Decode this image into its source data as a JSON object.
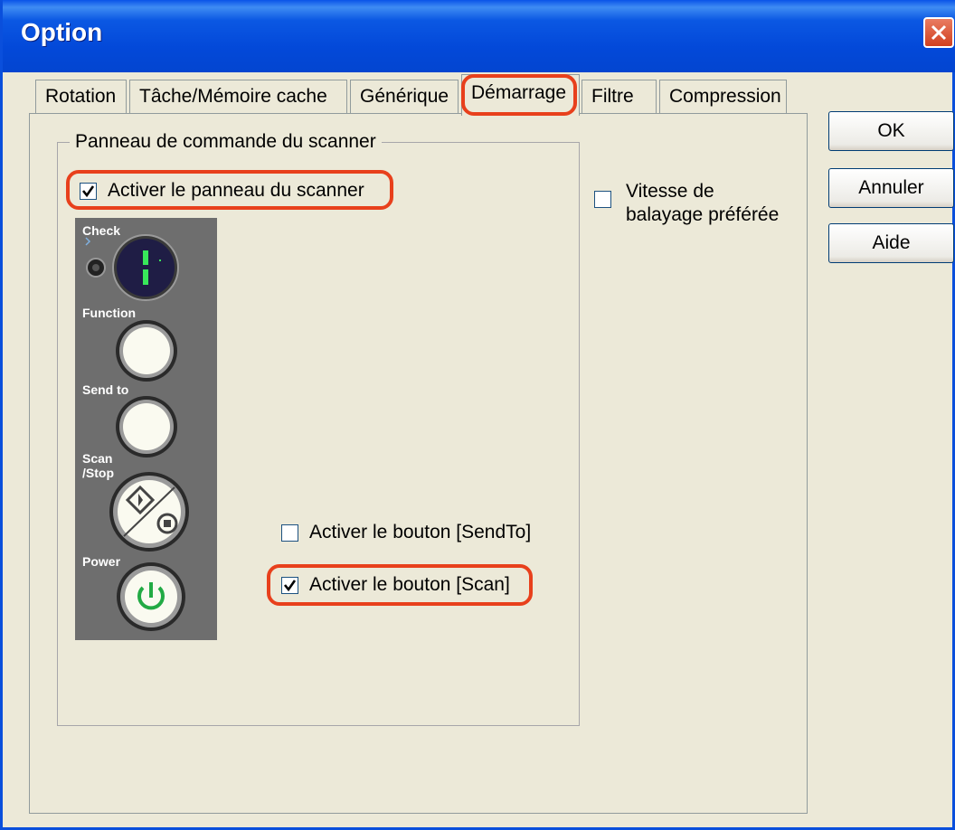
{
  "window": {
    "title": "Option",
    "close_icon": "close-icon"
  },
  "tabs": [
    {
      "label": "Rotation"
    },
    {
      "label": "Tâche/Mémoire cache"
    },
    {
      "label": "Générique"
    },
    {
      "label": "Démarrage",
      "active": true
    },
    {
      "label": "Filtre"
    },
    {
      "label": "Compression"
    }
  ],
  "buttons": {
    "ok": "OK",
    "cancel": "Annuler",
    "help": "Aide"
  },
  "group": {
    "title": "Panneau de commande du scanner",
    "enable_panel": {
      "label": "Activer le panneau du scanner",
      "checked": true
    },
    "enable_sendto": {
      "label": "Activer le bouton [SendTo]",
      "checked": false
    },
    "enable_scan": {
      "label": "Activer le bouton [Scan]",
      "checked": true
    }
  },
  "preferred_speed": {
    "line1": "Vitesse de",
    "line2": "balayage préférée",
    "checked": false
  },
  "scanner_panel": {
    "check_label": "Check",
    "display_value": "1",
    "function_label": "Function",
    "sendto_label": "Send to",
    "scan_label_1": "Scan",
    "scan_label_2": "/Stop",
    "power_label": "Power"
  },
  "colors": {
    "highlight": "#E8401C",
    "titlebar": "#0349D9",
    "dialog_bg": "#ECE9D8",
    "power_green": "#22AA44"
  }
}
